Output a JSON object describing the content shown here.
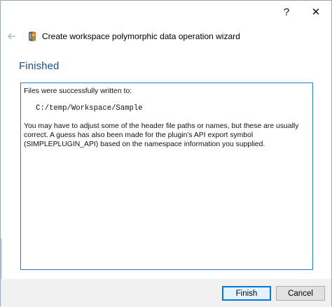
{
  "titlebar": {
    "help_label": "?",
    "close_label": "✕"
  },
  "header": {
    "back_icon": "back-arrow-icon",
    "app_icon": "wizard-app-icon",
    "title": "Create workspace polymorphic data operation wizard"
  },
  "page": {
    "heading": "Finished",
    "message_intro": "Files were successfully written to:",
    "path": "C:/temp/Workspace/Sample",
    "message_body": "You may have to adjust some of the header file paths or names, but these are usually correct. A guess has also been made for the plugin's API export symbol (SIMPLEPLUGIN_API) based on the namespace information you supplied."
  },
  "footer": {
    "finish_label": "Finish",
    "cancel_label": "Cancel"
  },
  "colors": {
    "heading": "#1a4f8f",
    "text_area_border": "#2f78c4",
    "primary_button_border": "#0078d7",
    "footer_background": "#f0f0f0"
  }
}
